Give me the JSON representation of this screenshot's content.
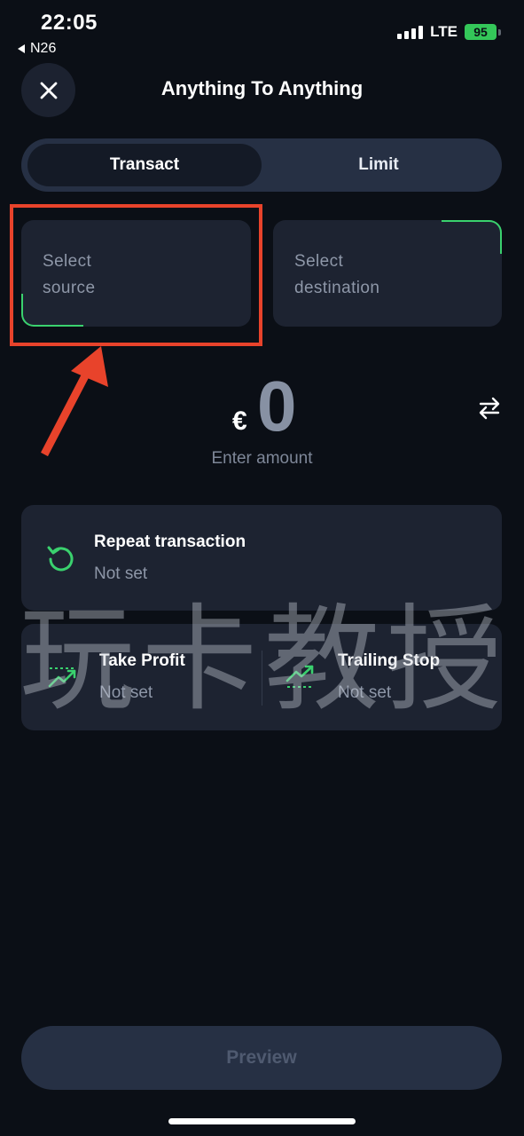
{
  "status_bar": {
    "time": "22:05",
    "back_app": "N26",
    "network": "LTE",
    "battery": "95"
  },
  "header": {
    "title": "Anything To Anything",
    "close_icon": "close-icon"
  },
  "tabs": [
    {
      "label": "Transact",
      "active": true
    },
    {
      "label": "Limit",
      "active": false
    }
  ],
  "source": {
    "label_line1": "Select",
    "label_line2": "source"
  },
  "destination": {
    "label_line1": "Select",
    "label_line2": "destination"
  },
  "amount": {
    "currency": "€",
    "value": "0",
    "hint": "Enter amount",
    "swap_icon": "swap-icon"
  },
  "repeat": {
    "title": "Repeat transaction",
    "value": "Not set",
    "icon": "repeat-icon"
  },
  "take_profit": {
    "title": "Take Profit",
    "value": "Not set",
    "icon": "take-profit-icon"
  },
  "trailing_stop": {
    "title": "Trailing Stop",
    "value": "Not set",
    "icon": "trailing-stop-icon"
  },
  "watermark": "玩卡教授",
  "preview_button": "Preview",
  "colors": {
    "background": "#0b0f16",
    "card": "#1d2331",
    "accent_green": "#3ad16e",
    "highlight_red": "#e8432b",
    "muted_text": "#8e97a8"
  }
}
